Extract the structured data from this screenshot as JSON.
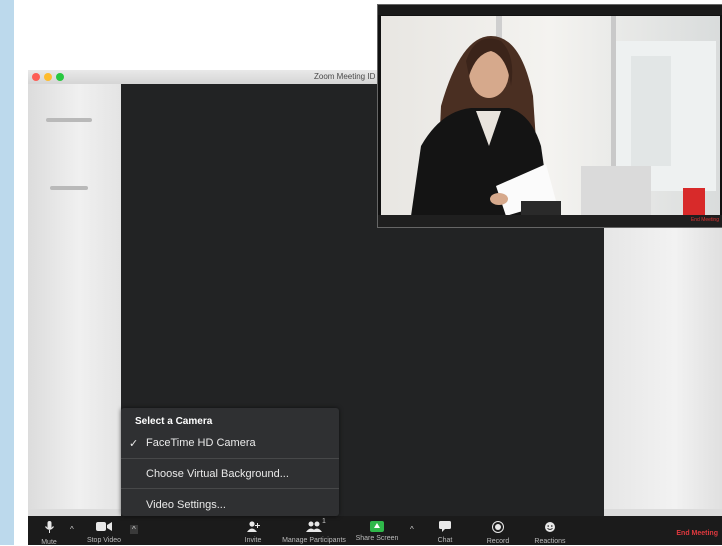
{
  "window": {
    "title": "Zoom Meeting ID"
  },
  "camera_menu": {
    "title": "Select a Camera",
    "items": [
      {
        "label": "FaceTime HD Camera",
        "checked": true
      },
      {
        "label": "Choose Virtual Background..."
      },
      {
        "label": "Video Settings..."
      }
    ]
  },
  "toolbar": {
    "mute": "Mute",
    "stop_video": "Stop Video",
    "invite": "Invite",
    "manage_participants": "Manage Participants",
    "participant_count": "1",
    "share_screen": "Share Screen",
    "chat": "Chat",
    "record": "Record",
    "reactions": "Reactions",
    "end_meeting": "End Meeting"
  },
  "colors": {
    "end": "#e0393e",
    "share": "#2fb84a",
    "menu_bg": "#2f3032",
    "toolbar_bg": "#1b1b1b"
  }
}
